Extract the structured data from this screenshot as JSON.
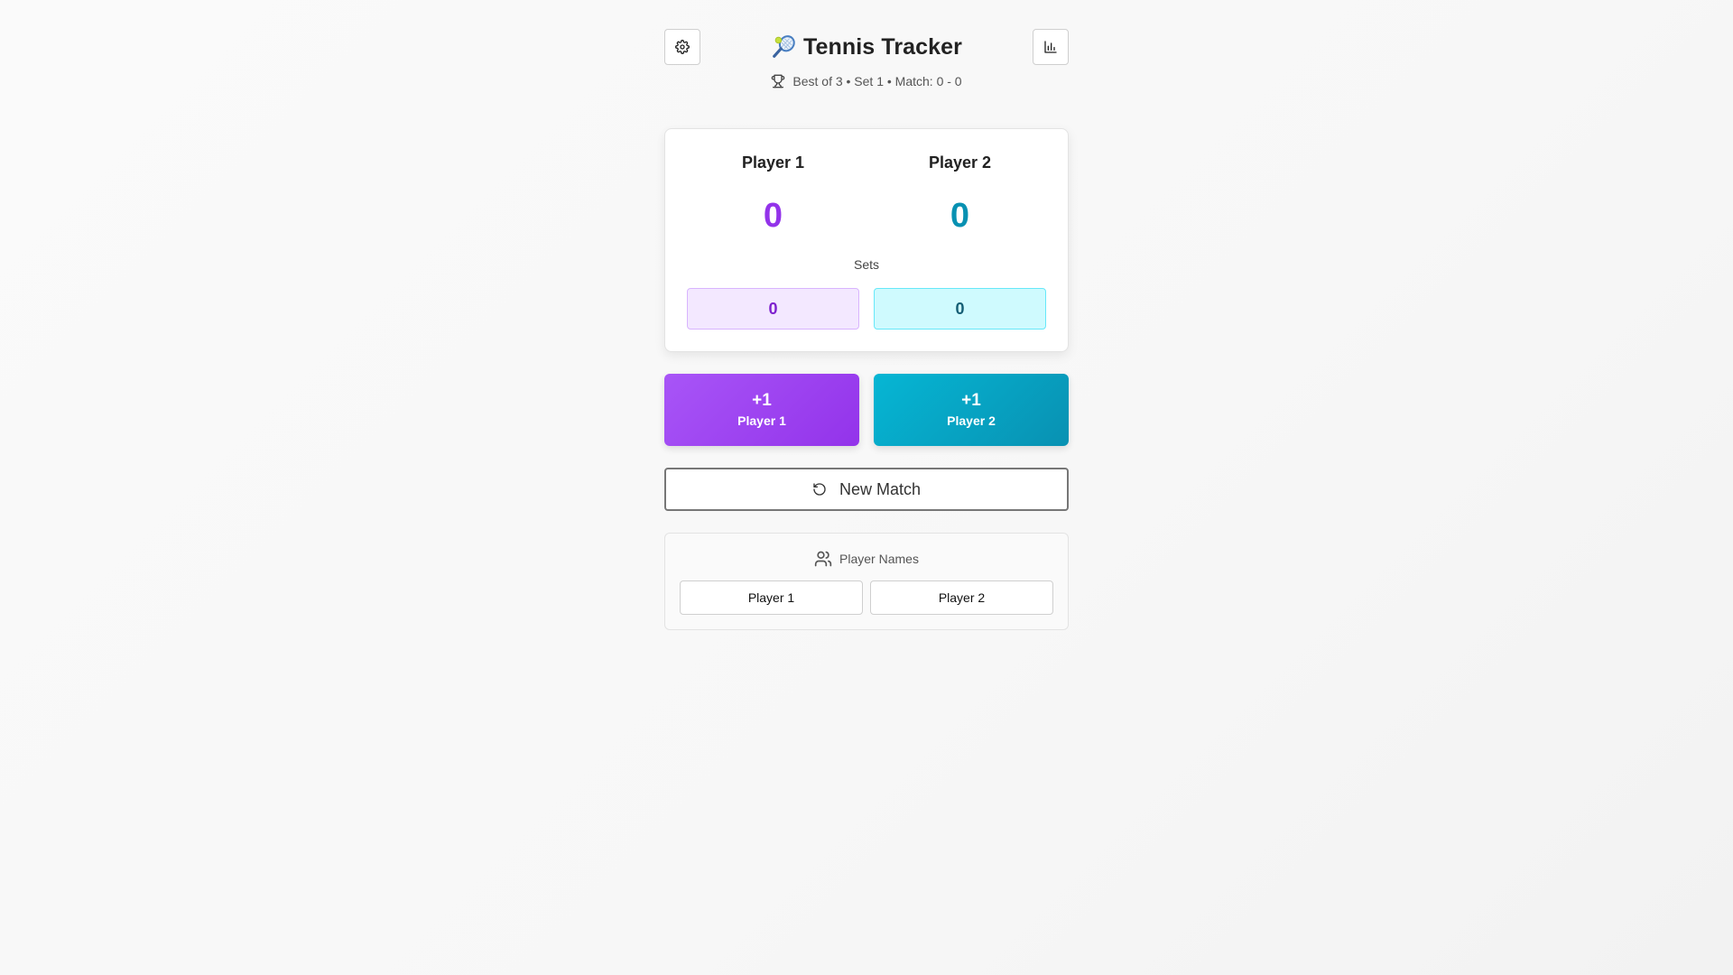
{
  "header": {
    "title": "Tennis Tracker",
    "settings_icon": "gear-icon",
    "stats_icon": "bar-chart-icon",
    "title_icon": "tennis-racket-icon"
  },
  "subtitle": {
    "icon": "trophy-icon",
    "text": "Best of 3 • Set 1 • Match: 0 - 0"
  },
  "scoreboard": {
    "player1": {
      "name": "Player 1",
      "score": "0",
      "sets": "0",
      "color": "#9333ea"
    },
    "player2": {
      "name": "Player 2",
      "score": "0",
      "sets": "0",
      "color": "#0891b2"
    },
    "sets_label": "Sets"
  },
  "point_buttons": {
    "player1": {
      "plus": "+1",
      "label": "Player 1"
    },
    "player2": {
      "plus": "+1",
      "label": "Player 2"
    }
  },
  "new_match": {
    "label": "New Match",
    "icon": "rotate-ccw-icon"
  },
  "player_names": {
    "label": "Player Names",
    "icon": "users-icon",
    "player1_value": "Player 1",
    "player2_value": "Player 2"
  }
}
